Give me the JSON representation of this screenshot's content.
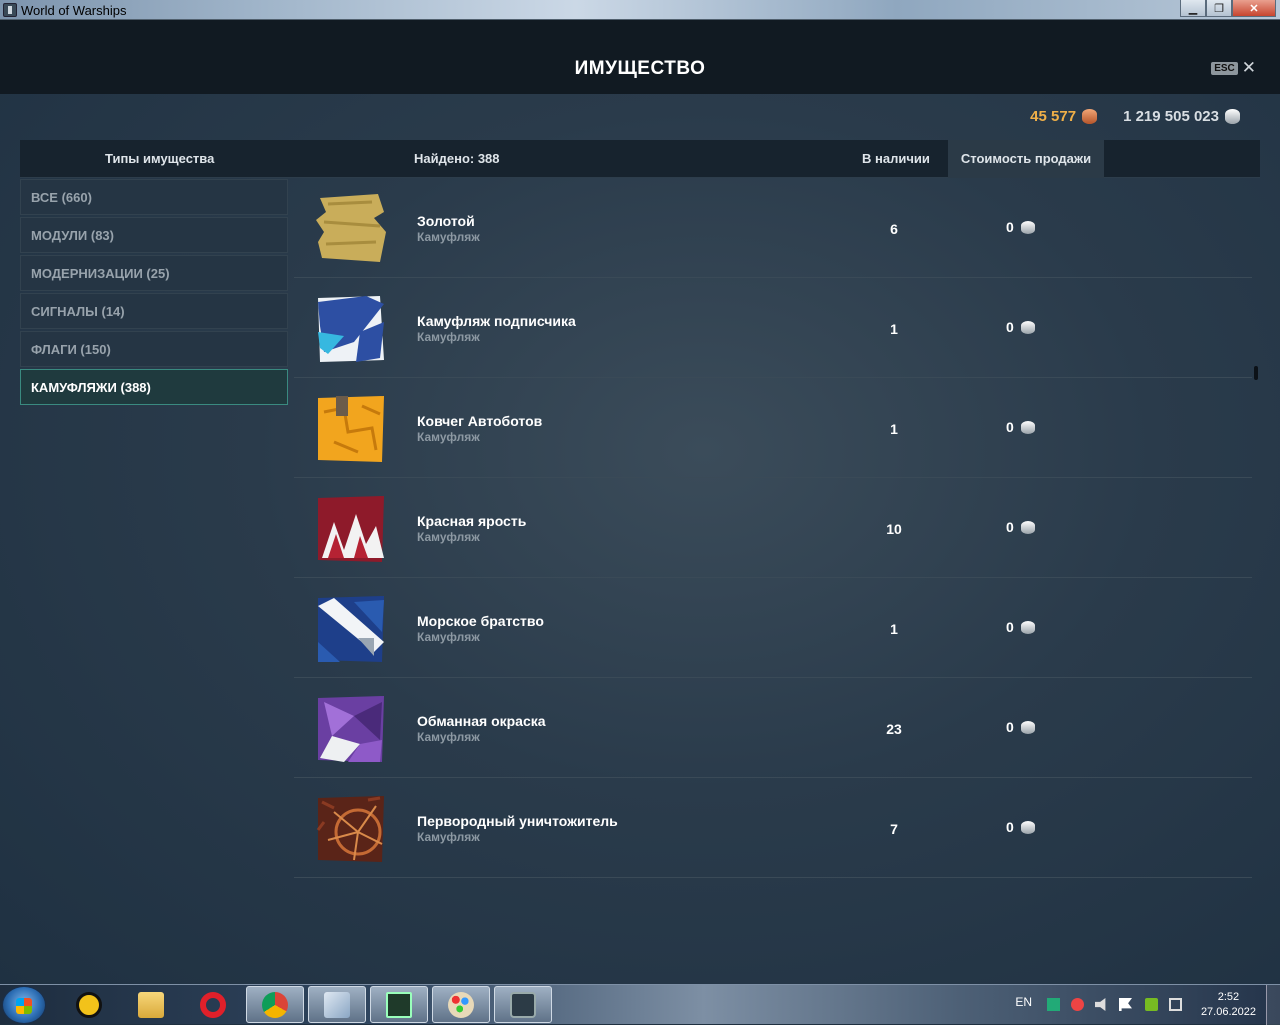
{
  "window": {
    "title": "World of Warships",
    "minimize_icon": "minimize-icon",
    "maximize_icon": "restore-icon",
    "close_icon": "close-icon"
  },
  "header": {
    "title": "ИМУЩЕСТВО",
    "esc_label": "ESC",
    "close_glyph": "✕"
  },
  "currency": {
    "doubloons": "45 577",
    "doubloons_icon": "doubloon-icon",
    "credits": "1 219 505 023",
    "credits_icon": "credits-icon"
  },
  "columns": {
    "types": "Типы имущества",
    "found": "Найдено: 388",
    "stock": "В наличии",
    "price": "Стоимость продажи"
  },
  "sidebar": {
    "items": [
      {
        "label": "ВСЕ (660)",
        "active": false
      },
      {
        "label": "МОДУЛИ (83)",
        "active": false
      },
      {
        "label": "МОДЕРНИЗАЦИИ (25)",
        "active": false
      },
      {
        "label": "СИГНАЛЫ (14)",
        "active": false
      },
      {
        "label": "ФЛАГИ (150)",
        "active": false
      },
      {
        "label": "КАМУФЛЯЖИ (388)",
        "active": true
      }
    ]
  },
  "items": [
    {
      "name": "Золотой",
      "type": "Камуфляж",
      "qty": "6",
      "price": "0",
      "icon": "gold-camo-icon"
    },
    {
      "name": "Камуфляж подписчика",
      "type": "Камуфляж",
      "qty": "1",
      "price": "0",
      "icon": "subscriber-camo-icon"
    },
    {
      "name": "Ковчег Автоботов",
      "type": "Камуфляж",
      "qty": "1",
      "price": "0",
      "icon": "autobots-ark-camo-icon"
    },
    {
      "name": "Красная ярость",
      "type": "Камуфляж",
      "qty": "10",
      "price": "0",
      "icon": "red-fury-camo-icon"
    },
    {
      "name": "Морское братство",
      "type": "Камуфляж",
      "qty": "1",
      "price": "0",
      "icon": "sea-brotherhood-camo-icon"
    },
    {
      "name": "Обманная окраска",
      "type": "Камуфляж",
      "qty": "23",
      "price": "0",
      "icon": "deceptive-paint-camo-icon"
    },
    {
      "name": "Первородный уничтожитель",
      "type": "Камуфляж",
      "qty": "7",
      "price": "0",
      "icon": "primordial-destroyer-camo-icon"
    }
  ],
  "taskbar": {
    "lang": "EN",
    "time": "2:52",
    "date": "27.06.2022"
  }
}
